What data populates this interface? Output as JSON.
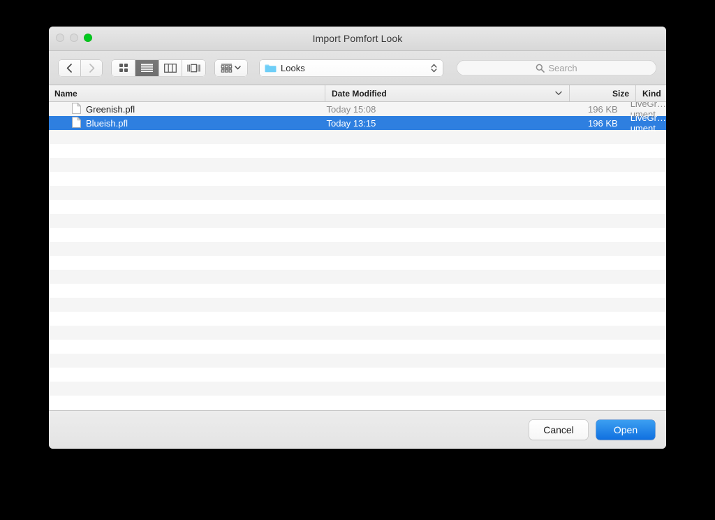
{
  "window": {
    "title": "Import Pomfort Look",
    "traffic_lights": [
      {
        "name": "close",
        "color": "#d9d9d9"
      },
      {
        "name": "minimize",
        "color": "#d9d9d9"
      },
      {
        "name": "zoom",
        "color": "#00ca1f"
      }
    ]
  },
  "toolbar": {
    "back_icon": "chevron-left-icon",
    "forward_icon": "chevron-right-icon",
    "view_modes": [
      {
        "name": "icon-view",
        "icon": "grid-icon",
        "active": false
      },
      {
        "name": "list-view",
        "icon": "list-icon",
        "active": true
      },
      {
        "name": "column-view",
        "icon": "columns-icon",
        "active": false
      },
      {
        "name": "gallery-view",
        "icon": "gallery-icon",
        "active": false
      }
    ],
    "arrange_icon": "arrange-group-icon",
    "arrange_chevron": "chevron-down-icon",
    "path_popup": {
      "icon": "folder-icon",
      "label": "Looks",
      "stepper_icon": "stepper-updown-icon"
    },
    "search": {
      "icon": "search-icon",
      "placeholder": "Search",
      "value": ""
    }
  },
  "file_browser": {
    "columns": [
      {
        "key": "name",
        "label": "Name"
      },
      {
        "key": "date",
        "label": "Date Modified",
        "sort_indicator": "chevron-down-icon"
      },
      {
        "key": "size",
        "label": "Size"
      },
      {
        "key": "kind",
        "label": "Kind"
      }
    ],
    "rows": [
      {
        "icon": "document-icon",
        "name": "Greenish.pfl",
        "date": "Today 15:08",
        "size": "196 KB",
        "kind": "LiveGr…ument",
        "selected": false
      },
      {
        "icon": "document-icon",
        "name": "Blueish.pfl",
        "date": "Today 13:15",
        "size": "196 KB",
        "kind": "LiveGr…ument",
        "selected": true
      }
    ],
    "empty_row_count": 20,
    "selection_color": "#2e7fe0"
  },
  "footer": {
    "cancel_label": "Cancel",
    "open_label": "Open",
    "primary_color": "#1070e0"
  }
}
